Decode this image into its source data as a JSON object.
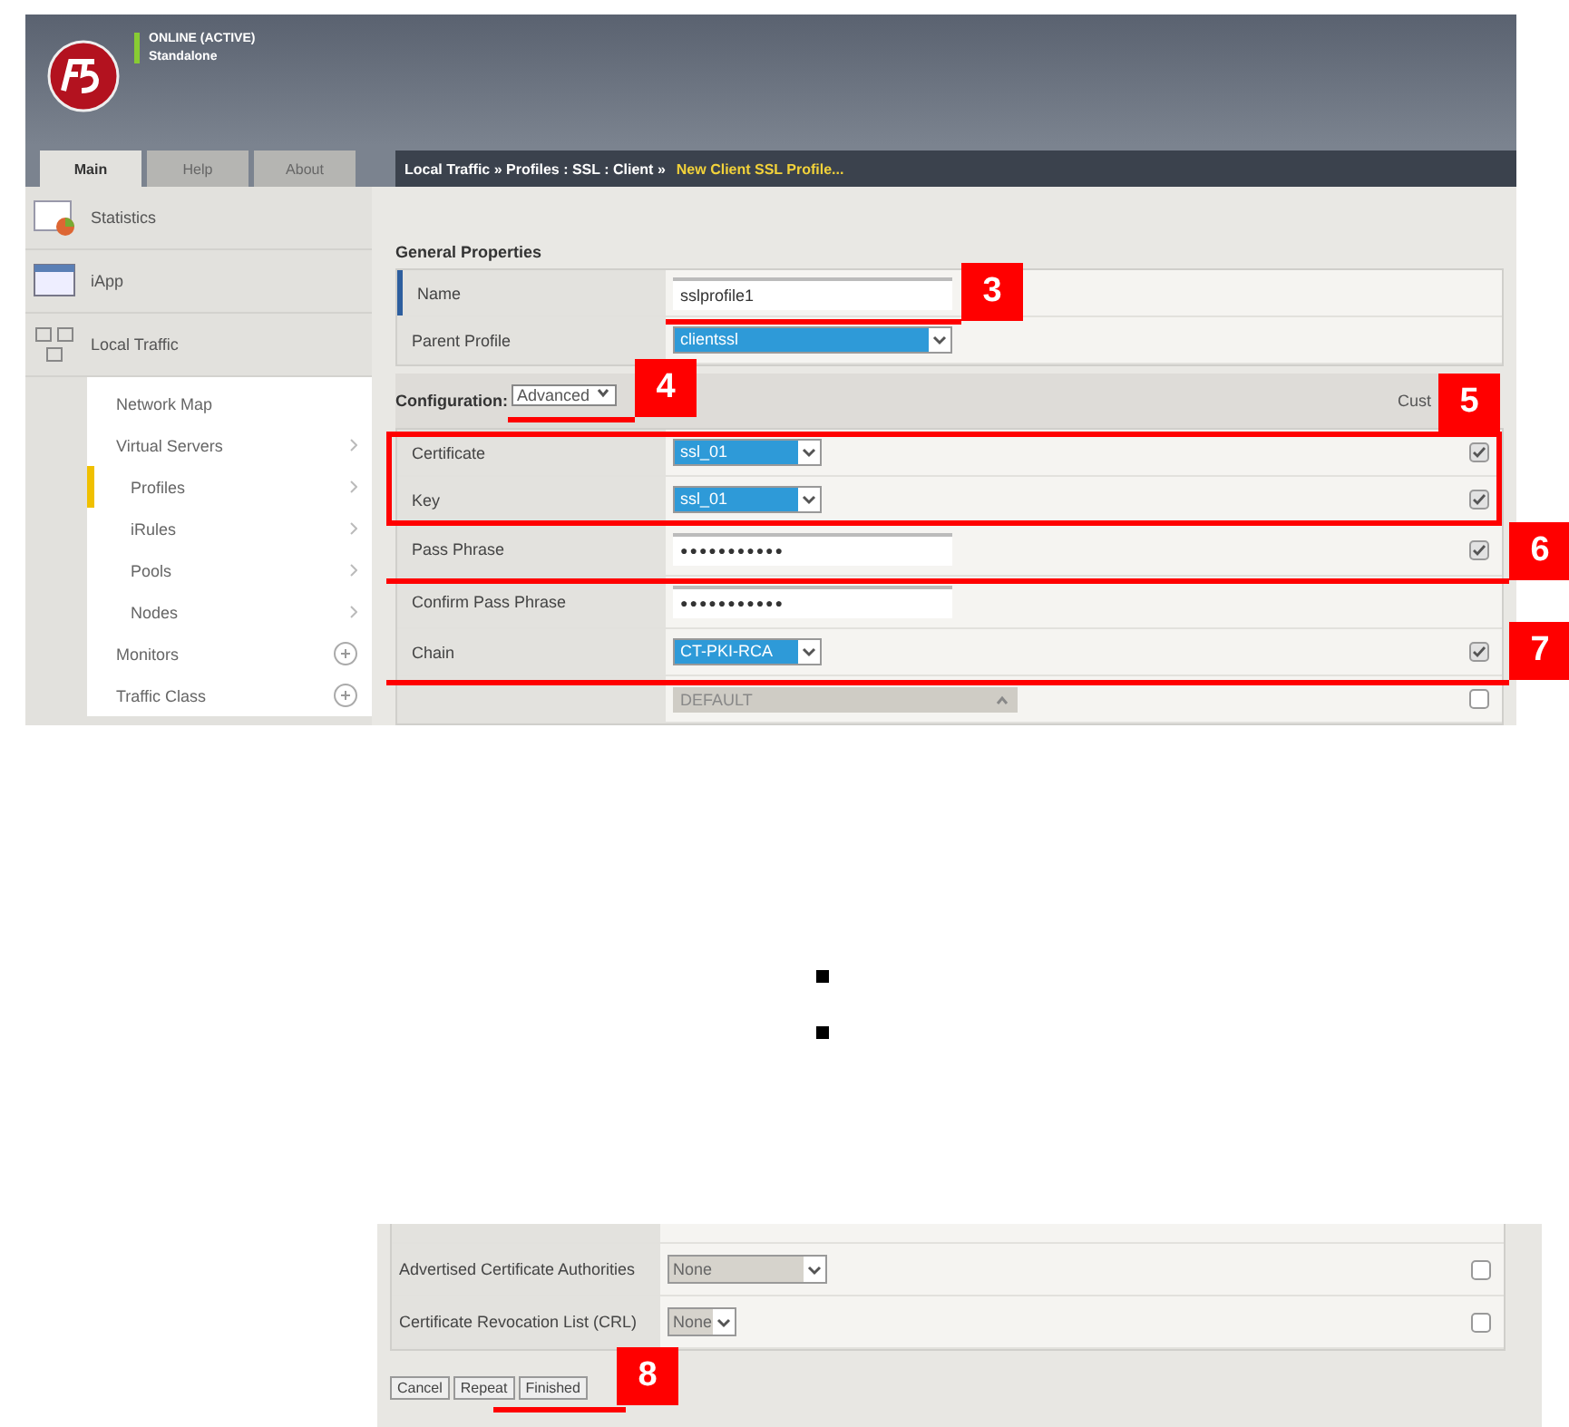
{
  "header": {
    "status": "ONLINE (ACTIVE)",
    "mode": "Standalone"
  },
  "tabs": [
    {
      "label": "Main",
      "selected": true
    },
    {
      "label": "Help",
      "selected": false
    },
    {
      "label": "About",
      "selected": false
    }
  ],
  "breadcrumb": {
    "path": "Local Traffic  »  Profiles : SSL : Client  »",
    "current": "New Client SSL Profile..."
  },
  "sidebar": {
    "sections": [
      {
        "label": "Statistics",
        "kind": "stats"
      },
      {
        "label": "iApp",
        "kind": "iapp"
      },
      {
        "label": "Local Traffic",
        "kind": "traffic"
      }
    ],
    "items": [
      {
        "label": "Network Map",
        "kind": "plain",
        "selected": false
      },
      {
        "label": "Virtual Servers",
        "kind": "arrow",
        "selected": false,
        "children": [
          {
            "label": "Profiles",
            "kind": "arrow",
            "selected": true
          },
          {
            "label": "iRules",
            "kind": "arrow",
            "selected": false
          },
          {
            "label": "Pools",
            "kind": "arrow",
            "selected": false
          },
          {
            "label": "Nodes",
            "kind": "arrow",
            "selected": false
          }
        ]
      },
      {
        "label": "Monitors",
        "kind": "plus",
        "selected": false
      },
      {
        "label": "Traffic Class",
        "kind": "plus",
        "selected": false
      }
    ]
  },
  "general": {
    "title": "General Properties",
    "rows": [
      {
        "label": "Name",
        "kind": "text",
        "value": "sslprofile1"
      },
      {
        "label": "Parent Profile",
        "kind": "select",
        "value": "clientssl"
      }
    ]
  },
  "configuration": {
    "title": "Configuration:",
    "mode": "Advanced",
    "custom_header": "Cust",
    "rows": [
      {
        "label": "Certificate",
        "kind": "select",
        "value": "ssl_01",
        "custom": true
      },
      {
        "label": "Key",
        "kind": "select",
        "value": "ssl_01",
        "custom": true
      },
      {
        "label": "Pass Phrase",
        "kind": "password",
        "value": "●●●●●●●●●●●",
        "custom": true
      },
      {
        "label": "Confirm Pass Phrase",
        "kind": "password",
        "value": "●●●●●●●●●●●"
      },
      {
        "label": "Chain",
        "kind": "select",
        "value": "CT-PKI-RCA",
        "custom": true
      },
      {
        "label": "",
        "kind": "listbox",
        "value": "DEFAULT",
        "custom": false
      }
    ]
  },
  "bullets": [
    {
      "kind": "square"
    },
    {
      "kind": "square"
    }
  ],
  "lower": {
    "rows": [
      {
        "label": "Advertised Certificate Authorities",
        "kind": "disabled-select",
        "value": "None",
        "custom": false
      },
      {
        "label": "Certificate Revocation List (CRL)",
        "kind": "disabled-select",
        "value": "None",
        "custom": false
      }
    ],
    "buttons": [
      "Cancel",
      "Repeat",
      "Finished"
    ]
  },
  "annotations": [
    {
      "number": "3",
      "kind": "underline"
    },
    {
      "number": "4",
      "kind": "underline"
    },
    {
      "number": "5",
      "kind": "box"
    },
    {
      "number": "6",
      "kind": "underline"
    },
    {
      "number": "7",
      "kind": "underline"
    },
    {
      "number": "8",
      "kind": "underline"
    }
  ]
}
